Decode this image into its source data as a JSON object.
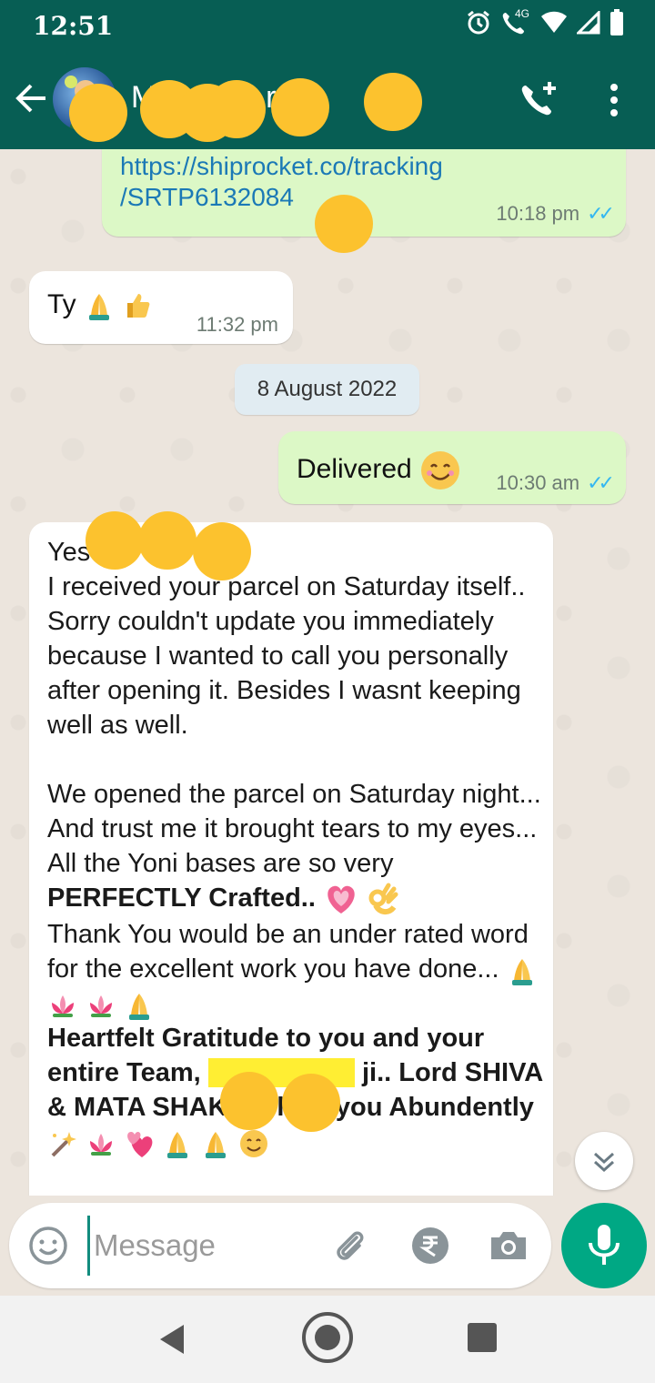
{
  "status_bar": {
    "time": "12:51",
    "network": "4G"
  },
  "header": {
    "contact_name": "M     Ko    ale    rti"
  },
  "colors": {
    "header": "#075e54",
    "outgoing": "#dcf8c6",
    "incoming": "#ffffff",
    "accent": "#00a884",
    "link": "#1b79b6",
    "read_ticks": "#34b7f1",
    "redaction": "#fcc22e"
  },
  "messages": [
    {
      "type": "outgoing",
      "line1": "https://shiprocket.co/tracking",
      "line2": "/SRTP6132084",
      "time": "10:18 pm",
      "read": true
    },
    {
      "type": "incoming",
      "text": "Ty",
      "emojis": [
        "folded-hands",
        "thumbs-up"
      ],
      "time": "11:32 pm"
    },
    {
      "type": "date",
      "text": "8 August 2022"
    },
    {
      "type": "outgoing",
      "text": "Delivered",
      "emojis": [
        "smiling-face"
      ],
      "time": "10:30 am",
      "read": true
    },
    {
      "type": "incoming",
      "greeting": "Yes",
      "p1": "I received your parcel on Saturday itself.. Sorry couldn't update you immediately because I wanted to call you personally after opening it. Besides I wasnt keeping well as well.",
      "p2": "We opened the parcel on Saturday night... And trust me it brought tears to my eyes... All the Yoni bases are so very",
      "p2_bold": "PERFECTLY Crafted..",
      "p3": "Thank You would be an under rated word for the excellent work you have done...",
      "p4_a": "Heartfelt Gratitude to you and your entire Team,",
      "p4_b": "ji.. Lord SHIVA & MATA SHAKTI Bless you Abundently"
    }
  ],
  "input": {
    "placeholder": "Message"
  }
}
